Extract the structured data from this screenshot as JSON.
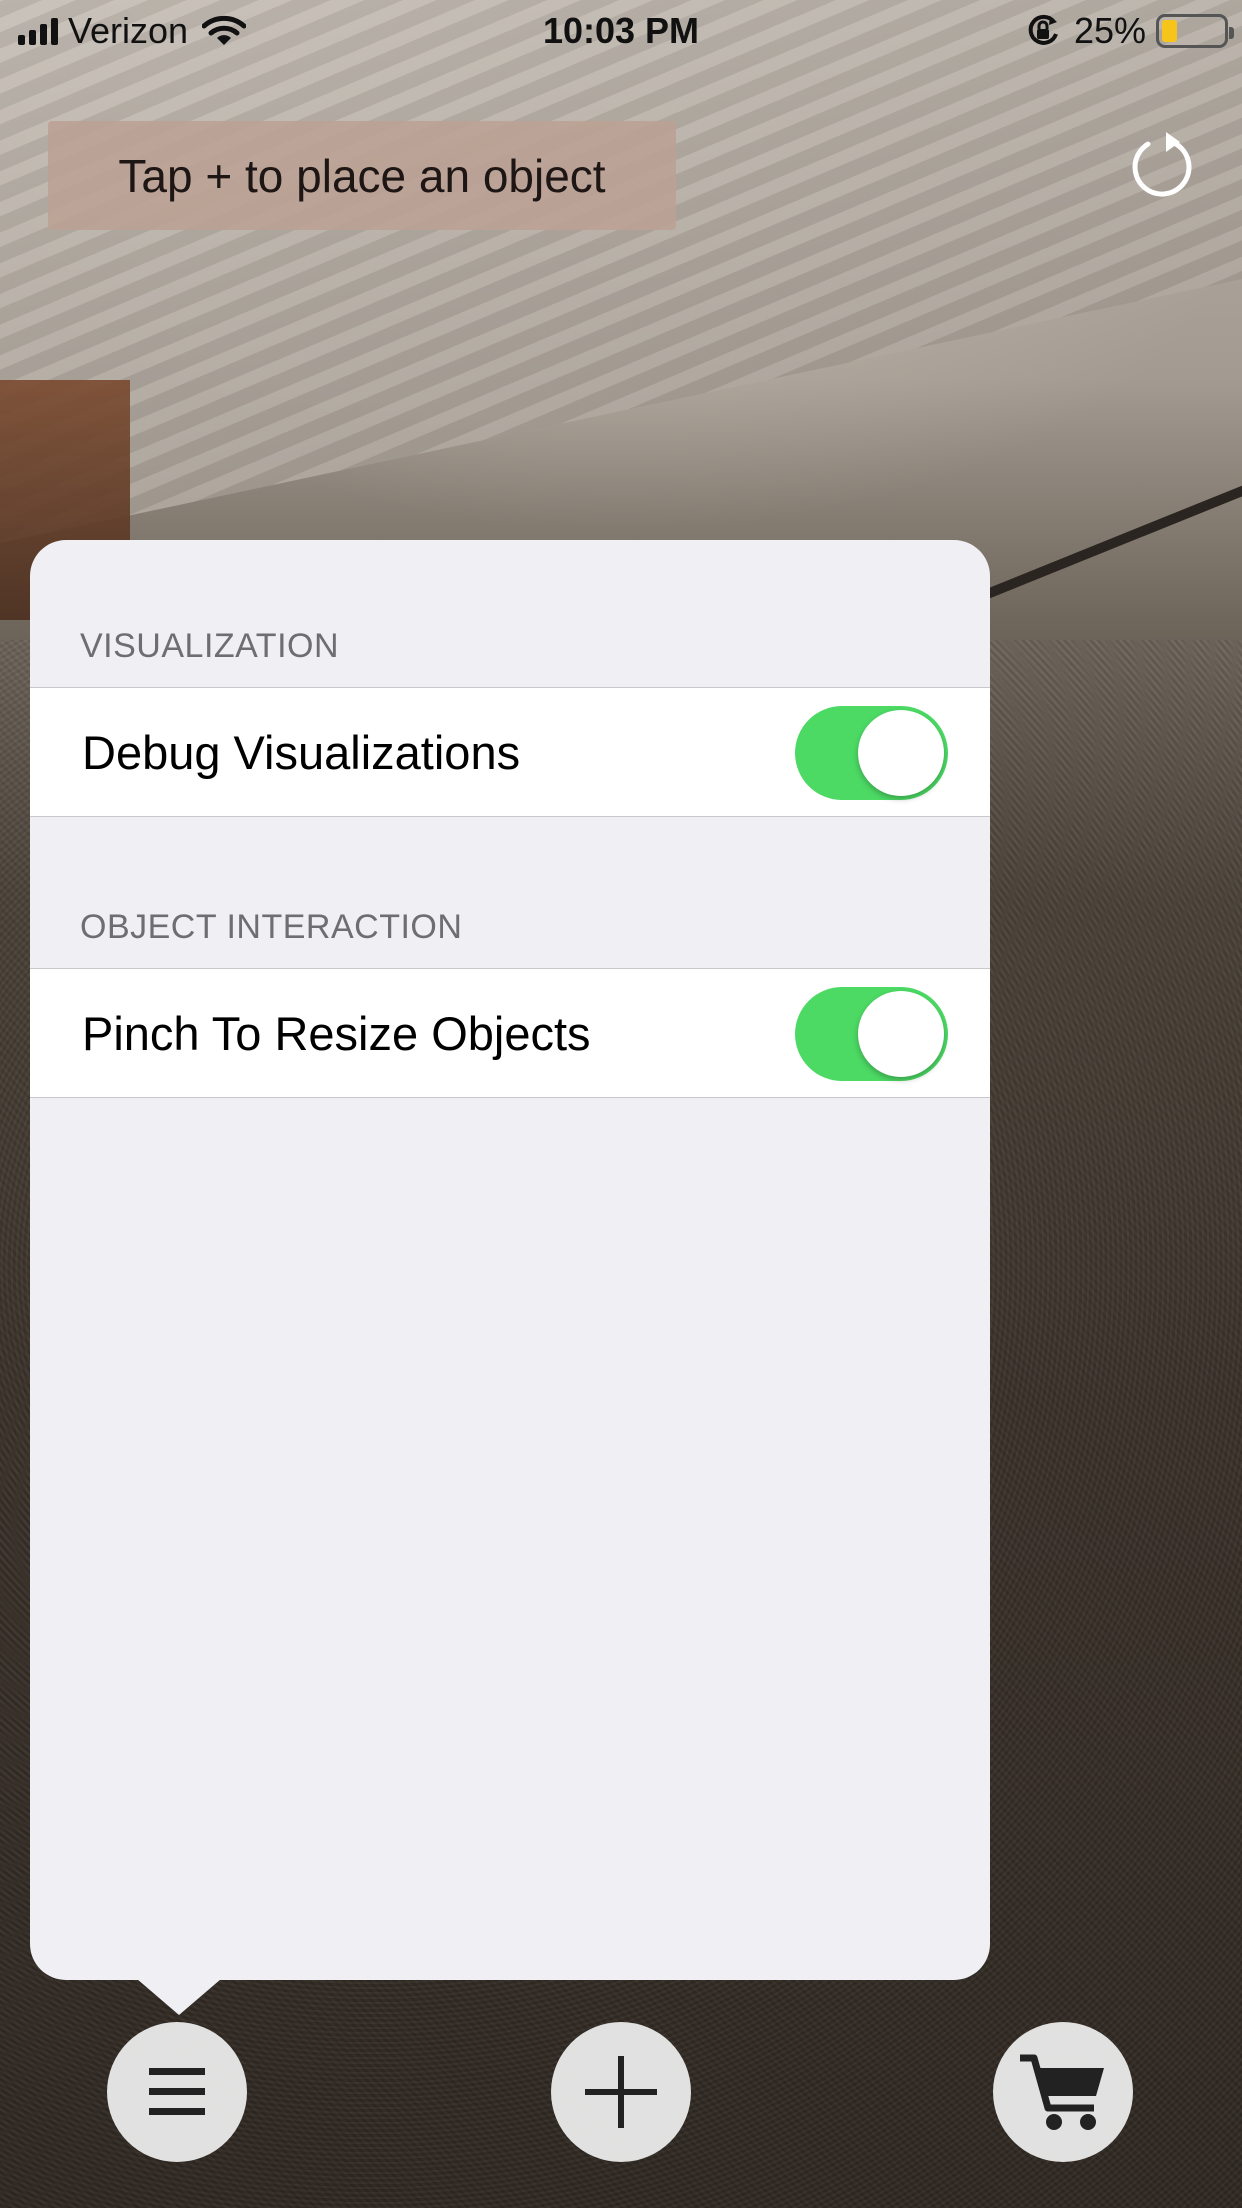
{
  "status_bar": {
    "carrier": "Verizon",
    "time": "10:03 PM",
    "battery_percent": "25%",
    "battery_level": 0.25,
    "battery_color": "#f7c41c"
  },
  "toast": {
    "message": "Tap + to place an object"
  },
  "settings_panel": {
    "sections": [
      {
        "header": "VISUALIZATION",
        "rows": [
          {
            "label": "Debug Visualizations",
            "toggle_on": true
          }
        ]
      },
      {
        "header": "OBJECT INTERACTION",
        "rows": [
          {
            "label": "Pinch To Resize Objects",
            "toggle_on": true
          }
        ]
      }
    ],
    "toggle_on_color": "#4cd964"
  },
  "toolbar": {
    "buttons": [
      {
        "icon": "menu-icon"
      },
      {
        "icon": "plus-icon"
      },
      {
        "icon": "cart-icon"
      }
    ]
  }
}
